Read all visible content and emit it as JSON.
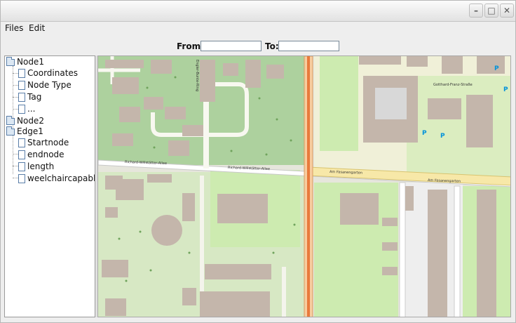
{
  "window": {
    "controls": {
      "minimize": "–",
      "maximize": "□",
      "close": "✕"
    }
  },
  "menu": {
    "files": "Files",
    "edit": "Edit"
  },
  "range": {
    "from_label": "From:",
    "from_value": "",
    "to_label": "To:",
    "to_value": ""
  },
  "tree": {
    "nodes": [
      {
        "label": "Node1",
        "type": "folder",
        "level": 0
      },
      {
        "label": "Coordinates",
        "type": "leaf",
        "level": 1
      },
      {
        "label": "Node Type",
        "type": "leaf",
        "level": 1
      },
      {
        "label": "Tag",
        "type": "leaf",
        "level": 1
      },
      {
        "label": "...",
        "type": "leaf",
        "level": 1
      },
      {
        "label": "Node2",
        "type": "folder",
        "level": 0
      },
      {
        "label": "Edge1",
        "type": "folder",
        "level": 0
      },
      {
        "label": "Startnode",
        "type": "leaf",
        "level": 1
      },
      {
        "label": "endnode",
        "type": "leaf",
        "level": 1
      },
      {
        "label": "length",
        "type": "leaf",
        "level": 1
      },
      {
        "label": "weelchaircapable",
        "type": "leaf",
        "level": 1
      }
    ]
  },
  "map": {
    "streets": {
      "richard_willstaetter_1": "Richard-Willstätter-Allee",
      "richard_willstaetter_2": "Richard-Willstätter-Allee",
      "am_fasanengarten_1": "Am Fasanengarten",
      "am_fasanengarten_2": "Am Fasanengarten",
      "gotthard_franz": "Gotthard-Franz-Straße",
      "engler_bunte": "Engler-Bunte-Ring"
    },
    "colors": {
      "forest": "#add19e",
      "grass": "#cdebb0",
      "building": "#c4b6ab",
      "campus": "#f0f0d8",
      "road_major": "#f7cda0",
      "road_minor": "#ffffff",
      "parking": "#eeeeee",
      "parking_sign": "#0092da"
    }
  }
}
